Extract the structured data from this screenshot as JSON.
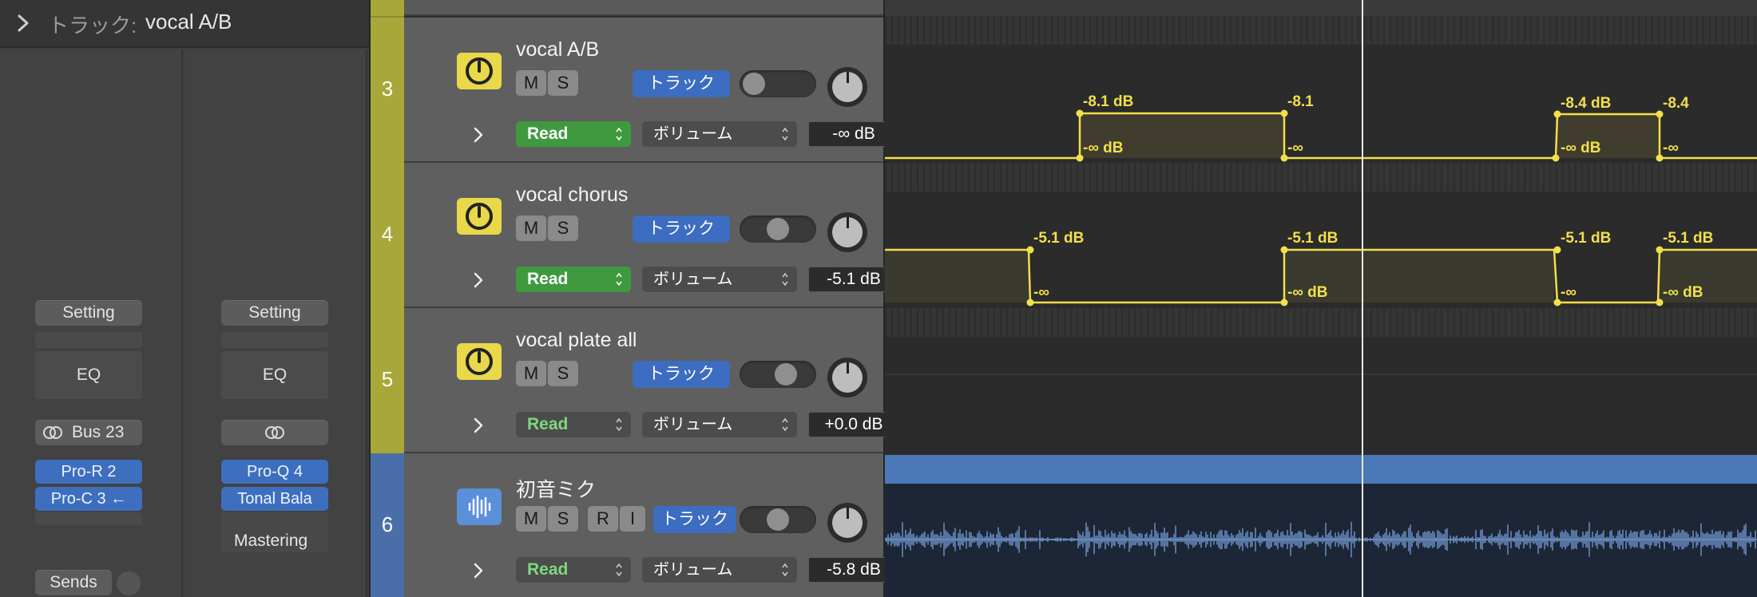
{
  "inspector": {
    "header_label": "トラック:",
    "header_value": "vocal A/B",
    "strip1": {
      "setting_label": "Setting",
      "eq_label": "EQ",
      "input_label": "Bus 23",
      "plugins": [
        "Pro-R 2",
        "Pro-C 3 ←"
      ],
      "sends_label": "Sends"
    },
    "strip2": {
      "setting_label": "Setting",
      "eq_label": "EQ",
      "plugins": [
        "Pro-Q 4",
        "Tonal Bala"
      ],
      "mastering_label": "Mastering"
    }
  },
  "tracks": [
    {
      "number": "3",
      "name": "vocal A/B",
      "mute": "M",
      "solo": "S",
      "track_btn": "トラック",
      "mode": "Read",
      "param": "ボリューム",
      "value": "-∞ dB"
    },
    {
      "number": "4",
      "name": "vocal chorus",
      "mute": "M",
      "solo": "S",
      "track_btn": "トラック",
      "mode": "Read",
      "param": "ボリューム",
      "value": "-5.1 dB"
    },
    {
      "number": "5",
      "name": "vocal plate all",
      "mute": "M",
      "solo": "S",
      "track_btn": "トラック",
      "mode": "Read",
      "param": "ボリューム",
      "value": "+0.0 dB"
    },
    {
      "number": "6",
      "name": "初音ミク",
      "mute": "M",
      "solo": "S",
      "record": "R",
      "input_monitor": "I",
      "track_btn": "トラック",
      "mode": "Read",
      "param": "ボリューム",
      "value": "-5.8 dB"
    }
  ],
  "automation_labels": {
    "track3": [
      "-8.1 dB",
      "-∞ dB",
      "-8.1",
      "-∞",
      "-8.4 dB",
      "-∞ dB",
      "-8.4",
      "-∞"
    ],
    "track4": [
      "-5.1 dB",
      "-∞",
      "-5.1 dB",
      "-∞ dB",
      "-5.1 dB",
      "-∞",
      "-5.1 dB",
      "-∞ dB"
    ]
  },
  "colors": {
    "accent_yellow": "#f2e04a",
    "track_blue": "#3c6dc0",
    "read_green": "#3f9a3f",
    "track_color_yellow": "#a8a83a",
    "track_color_blue": "#4a6fa8"
  }
}
